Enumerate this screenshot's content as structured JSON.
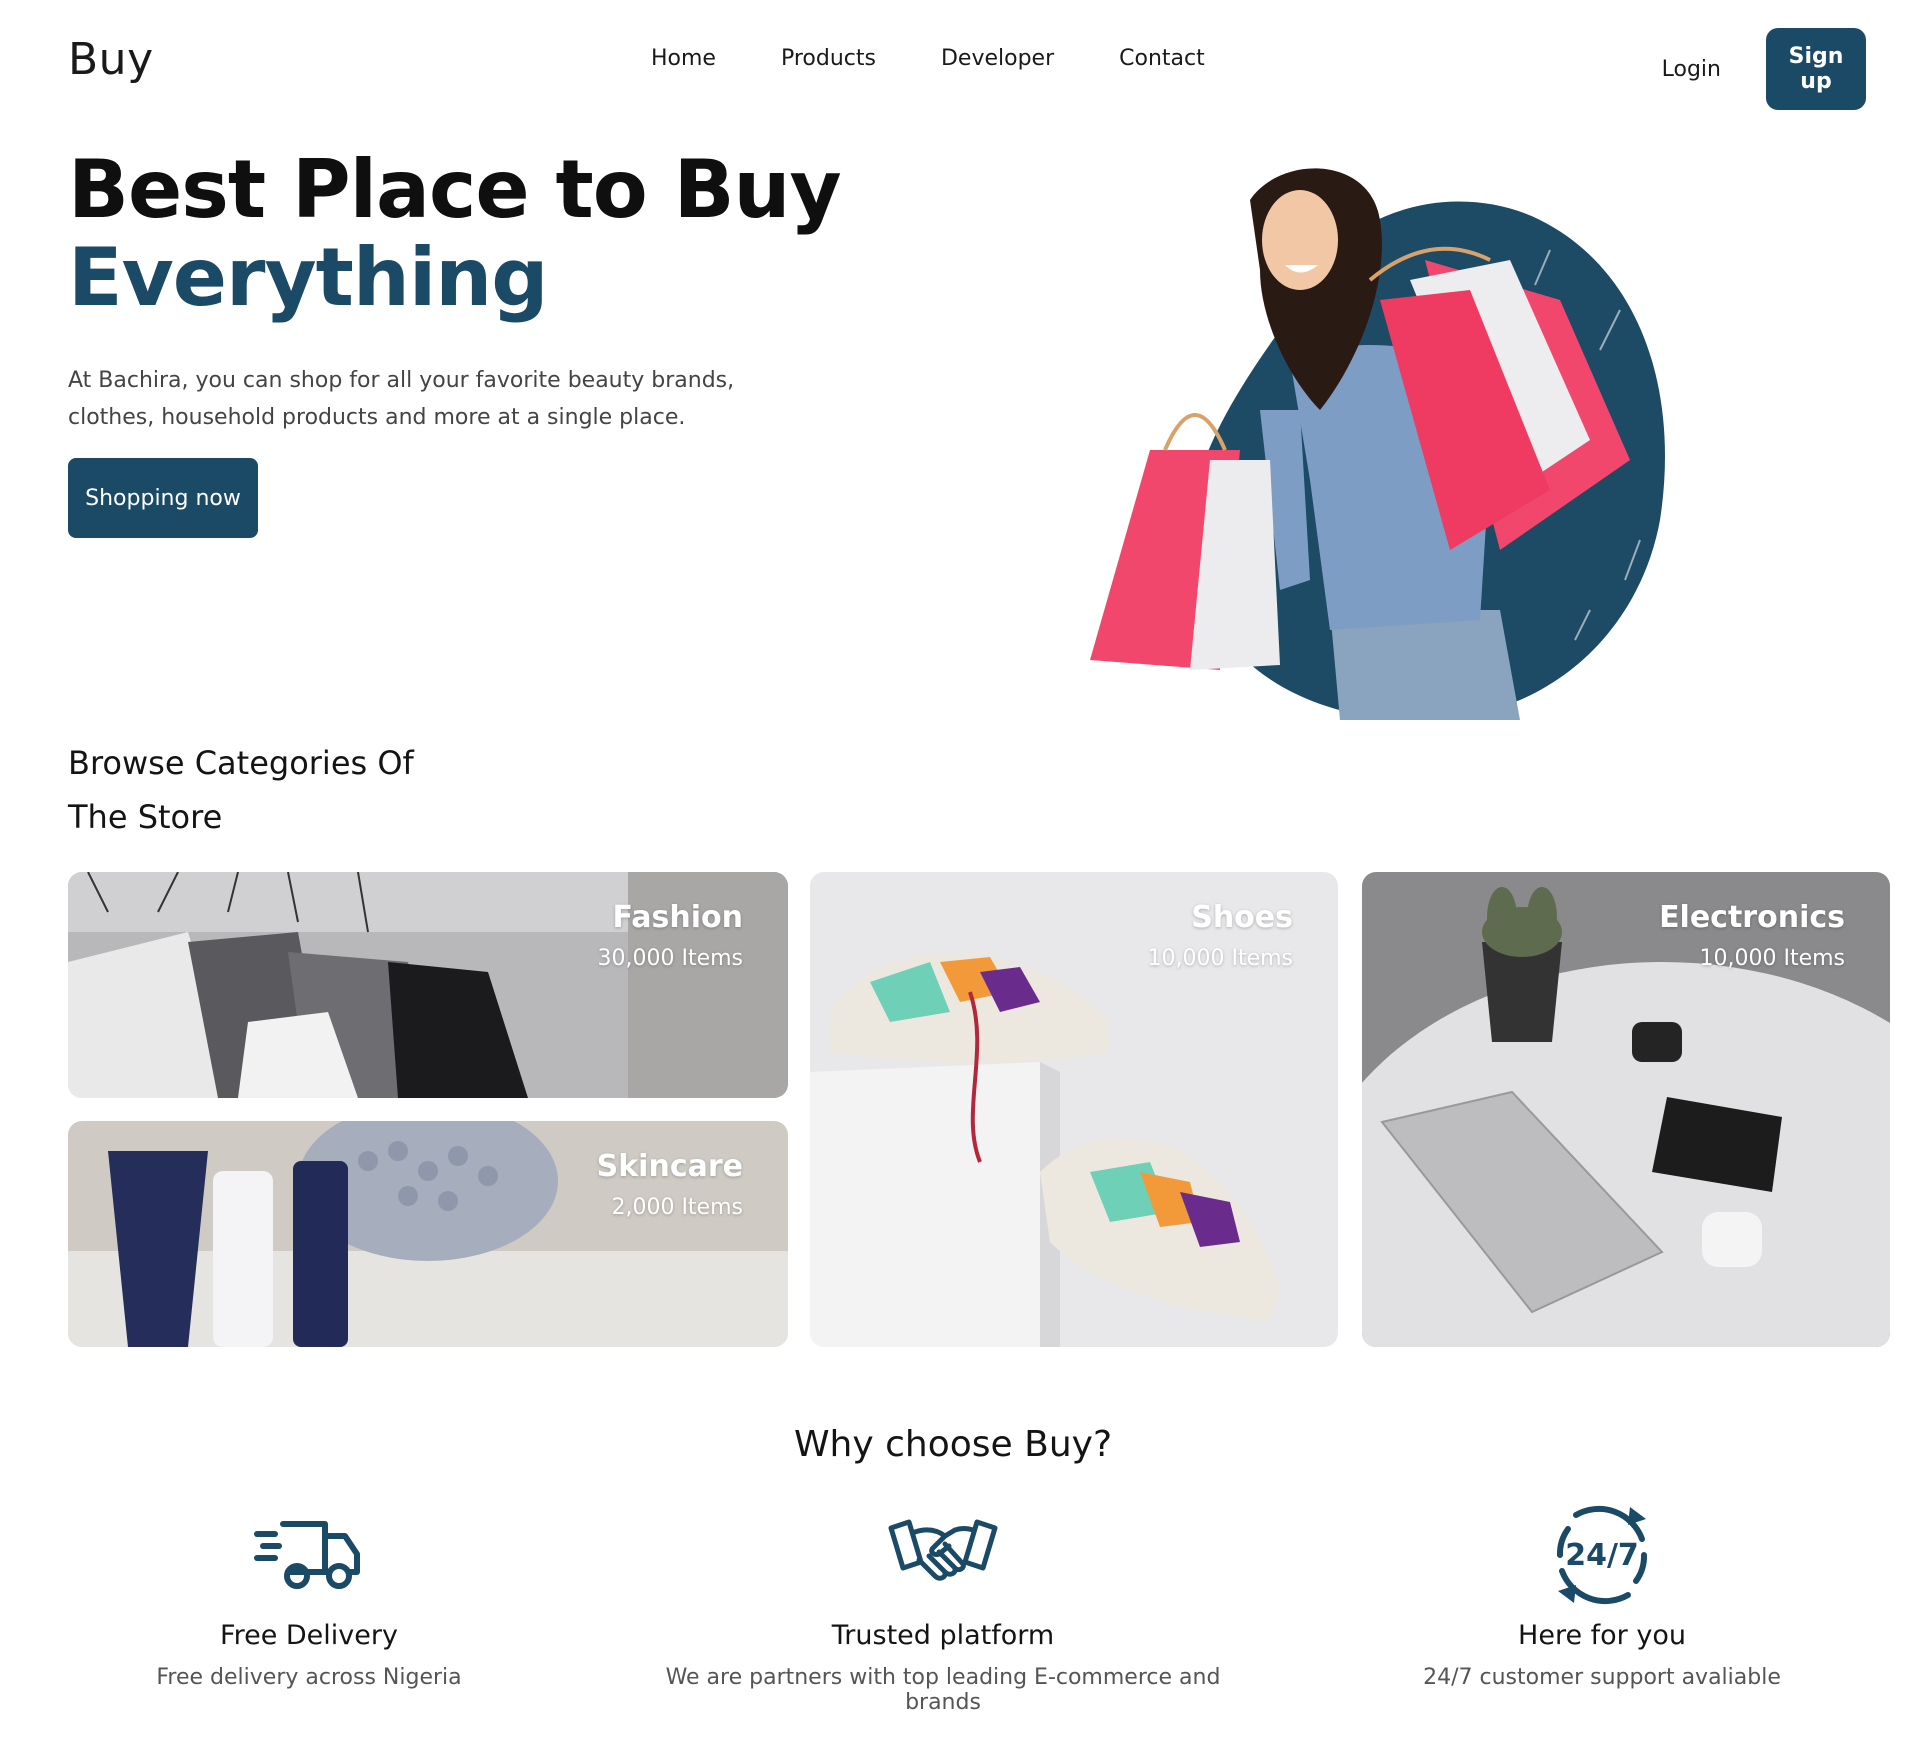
{
  "brand": "Buy",
  "nav": {
    "links": [
      "Home",
      "Products",
      "Developer",
      "Contact"
    ],
    "login": "Login",
    "signup": "Sign up"
  },
  "hero": {
    "title_line1": "Best Place to Buy",
    "title_line2": "Everything",
    "description": "At Bachira, you can shop for all your favorite beauty brands, clothes, household products and more at a single place.",
    "cta": "Shopping now"
  },
  "categories": {
    "heading": "Browse Categories Of The Store",
    "items": [
      {
        "name": "Fashion",
        "count": "30,000 Items"
      },
      {
        "name": "Skincare",
        "count": "2,000 Items"
      },
      {
        "name": "Shoes",
        "count": "10,000 Items"
      },
      {
        "name": "Electronics",
        "count": "10,000 Items"
      }
    ]
  },
  "why": {
    "title": "Why choose Buy?",
    "features": [
      {
        "icon": "delivery-truck-icon",
        "title": "Free Delivery",
        "desc": "Free delivery across Nigeria"
      },
      {
        "icon": "handshake-icon",
        "title": "Trusted platform",
        "desc": "We are partners with top leading E-commerce and brands"
      },
      {
        "icon": "support-24-7-icon",
        "title": "Here for you",
        "desc": "24/7 customer support avaliable"
      }
    ]
  },
  "colors": {
    "primary": "#1a4a66",
    "text": "#111111",
    "muted": "#555555"
  }
}
